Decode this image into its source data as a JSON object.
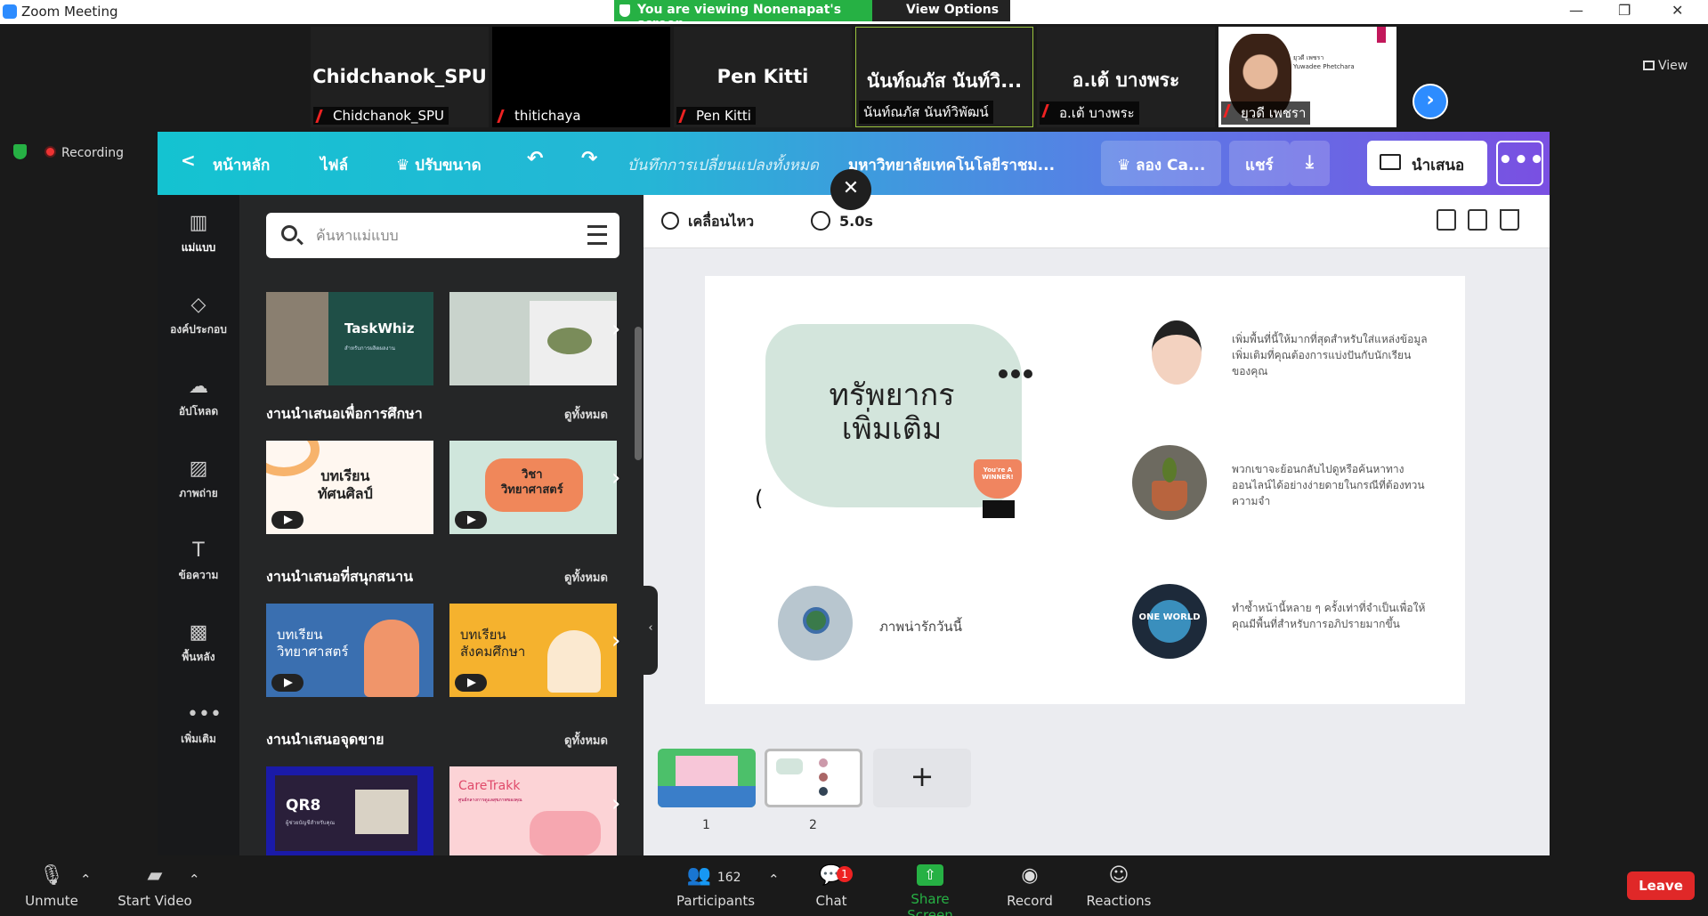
{
  "window": {
    "title": "Zoom Meeting",
    "minimize": "—",
    "restore": "❐",
    "close": "✕"
  },
  "banner": {
    "viewing": "You are viewing Nonenapat's screen",
    "view_options": "View Options ⌄"
  },
  "participants": [
    {
      "display": "Chidchanok_SPU",
      "label": "Chidchanok_SPU"
    },
    {
      "display": "",
      "label": "thitichaya"
    },
    {
      "display": "Pen Kitti",
      "label": "Pen Kitti"
    },
    {
      "display": "นันท์ณภัส นันท์วิ...",
      "label": "นันท์ณภัส นันท์วิพัฒน์"
    },
    {
      "display": "อ.เต้ บางพระ",
      "label": "อ.เต้ บางพระ"
    },
    {
      "display": "",
      "label": "ยุวดี เพชรา",
      "photo_name": "ยุวดี เพชรา",
      "photo_sub": "Yuwadee Phetchara"
    }
  ],
  "view_button": "View",
  "recording": "Recording",
  "canva": {
    "toolbar": {
      "back": "<",
      "home": "หน้าหลัก",
      "file": "ไฟล์",
      "resize": "♛ ปรับขนาด",
      "undo": "↶",
      "redo": "↷",
      "saved": "บันทึกการเปลี่ยนแปลงทั้งหมด",
      "doc_title": "มหาวิทยาลัยเทคโนโลยีราชม...",
      "try_canva": "♛ ลอง Ca...",
      "share": "แชร์",
      "download": "⤓",
      "present": "นำเสนอ",
      "more": "•••"
    },
    "nav": [
      {
        "icon": "template-icon",
        "glyph": "▥",
        "label": "แม่แบบ"
      },
      {
        "icon": "elements-icon",
        "glyph": "◇",
        "label": "องค์ประกอบ"
      },
      {
        "icon": "upload-icon",
        "glyph": "☁",
        "label": "อัปโหลด"
      },
      {
        "icon": "photo-icon",
        "glyph": "▨",
        "label": "ภาพถ่าย"
      },
      {
        "icon": "text-icon",
        "glyph": "T",
        "label": "ข้อความ"
      },
      {
        "icon": "background-icon",
        "glyph": "▩",
        "label": "พื้นหลัง"
      },
      {
        "icon": "more-icon",
        "glyph": "•••",
        "label": "เพิ่มเติม"
      }
    ],
    "search_placeholder": "ค้นหาแม่แบบ",
    "sections": [
      {
        "title": "งานนำเสนอเพื่อการศึกษา",
        "see_all": "ดูทั้งหมด"
      },
      {
        "title": "งานนำเสนอที่สนุกสนาน",
        "see_all": "ดูทั้งหมด"
      },
      {
        "title": "งานนำเสนอจุดขาย",
        "see_all": "ดูทั้งหมด"
      }
    ],
    "templates": {
      "taskwhiz": "TaskWhiz",
      "taskwhiz_sub": "สำหรับการผลิตผลงาน",
      "art": "บทเรียน\nทัศนศิลป์",
      "science1": "วิชา\nวิทยาศาสตร์",
      "science2": "บทเรียน\nวิทยาศาสตร์",
      "social": "บทเรียน\nสังคมศึกษา",
      "qr8": "QR8",
      "qr8_sub": "ผู้ช่วยบัญชีสำหรับคุณ",
      "caretrakk": "CareTrakk",
      "caretrakk_sub": "ศูนย์กลางการดูแลสุขภาพของคุณ"
    },
    "editor": {
      "animate": "เคลื่อนไหว",
      "duration": "5.0s",
      "close": "✕"
    },
    "slide": {
      "title": "ทรัพยากร\nเพิ่มเติม",
      "winner": "You're A WINNER!",
      "caption_bottom_left": "ภาพน่ารักวันนี้",
      "text1": "เพิ่มพื้นที่นี้ให้มากที่สุดสำหรับใส่แหล่งข้อมูลเพิ่มเติมที่คุณต้องการแบ่งปันกับนักเรียนของคุณ",
      "text2": "พวกเขาจะย้อนกลับไปดูหรือค้นหาทางออนไลน์ได้อย่างง่ายดายในกรณีที่ต้องทวนความจำ",
      "text3": "ทำซ้ำหน้านี้หลาย ๆ ครั้งเท่าที่จำเป็นเพื่อให้คุณมีพื้นที่สำหรับการอภิปรายมากขึ้น",
      "world": "ONE WORLD"
    },
    "pages": [
      "1",
      "2"
    ],
    "add_page": "+"
  },
  "bottom": {
    "unmute": "Unmute",
    "start_video": "Start Video",
    "participants": "Participants",
    "participant_count": "162",
    "chat": "Chat",
    "chat_badge": "1",
    "share_screen": "Share Screen",
    "record": "Record",
    "reactions": "Reactions",
    "leave": "Leave"
  }
}
